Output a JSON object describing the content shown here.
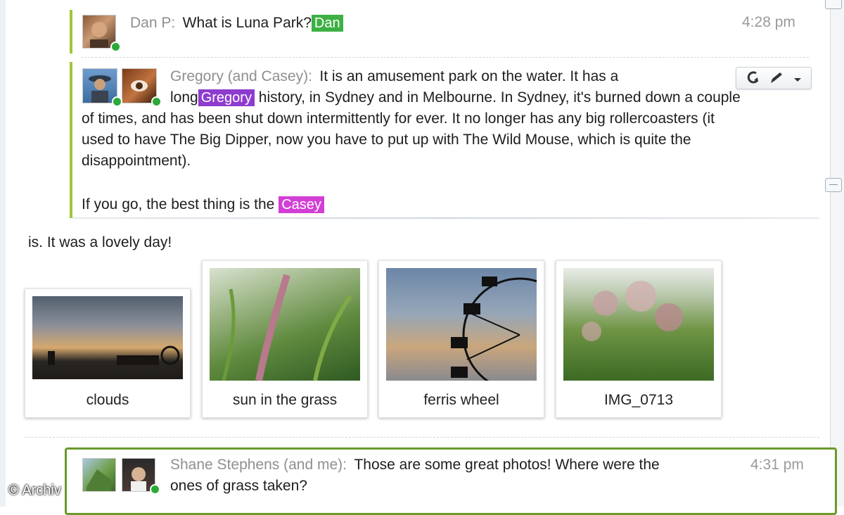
{
  "thread": {
    "msg1": {
      "author": "Dan P:",
      "text": "What is Luna Park?",
      "tag": "Dan",
      "tag_color": "#3cb043",
      "time": "4:28 pm"
    },
    "msg2": {
      "author": "Gregory (and Casey):",
      "line1": "It is an amusement park on the water. It has a",
      "line2a": "long",
      "tag1": "Gregory",
      "tag1_color": "#8e3bd0",
      "line2b": "history, in Sydney and in Melbourne. In Sydney, it's burned down a couple",
      "line3": "of times, and has been shut down intermittently for ever. It no longer has any big rollercoasters (it",
      "line4": "used to have The Big Dipper, now you have to put up with The Wild Mouse, which is quite the",
      "line5": "disappointment).",
      "line6": "If you go, the best thing is the",
      "tag2": "Casey",
      "tag2_color": "#d23fd6"
    },
    "continuation": "is. It was a lovely day!",
    "photos": [
      {
        "caption": "clouds",
        "icon": "photo-clouds"
      },
      {
        "caption": "sun in the grass",
        "icon": "photo-grass"
      },
      {
        "caption": "ferris wheel",
        "icon": "photo-ferris-wheel"
      },
      {
        "caption": "IMG_0713",
        "icon": "photo-flowers"
      }
    ],
    "msg3": {
      "author": "Shane Stephens (and me):",
      "text": "Those are some great photos!  Where were the",
      "text2": "ones of grass taken?",
      "time": "4:31 pm"
    }
  },
  "watermark": "© Archiv",
  "colors": {
    "thread_bar": "#9dc73a",
    "reply_border": "#6a9a2b",
    "online": "#2aaa38"
  }
}
